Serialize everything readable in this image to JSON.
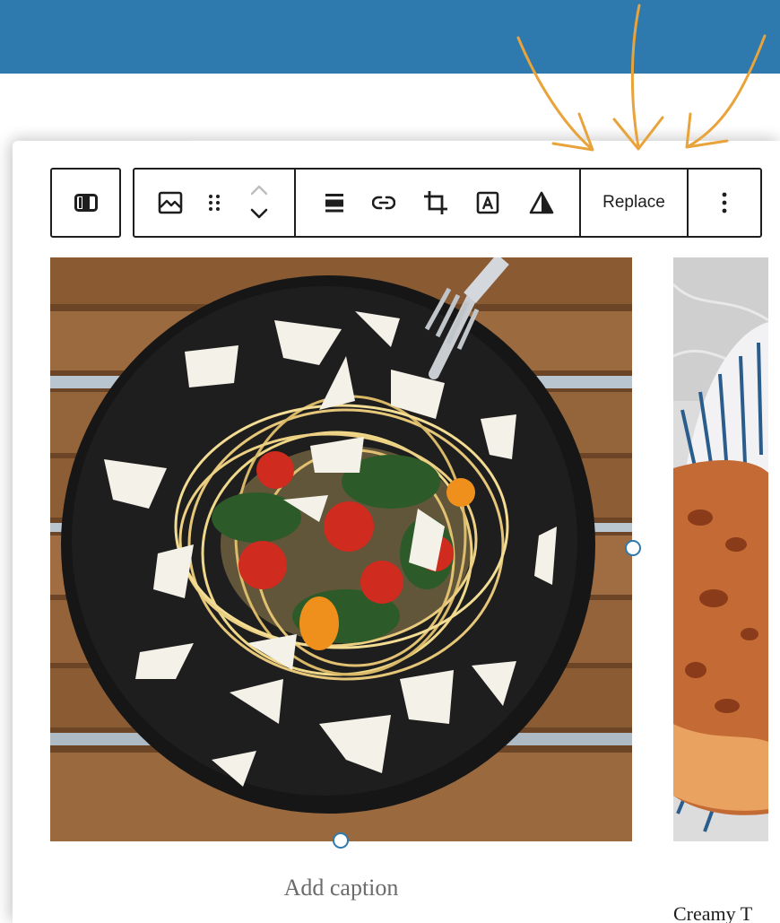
{
  "header": {
    "color": "#2e79ae"
  },
  "accent": {
    "arrows": "#e8a33a",
    "handles": "#2e79ae"
  },
  "toolbar": {
    "parent_select_icon": "columns-icon",
    "block_type_icon": "image-icon",
    "drag_icon": "drag-handle-icon",
    "move_icon": "chevron-up-down-icon",
    "align_icon": "align-icon",
    "link_icon": "link-icon",
    "crop_icon": "crop-icon",
    "text_overlay_icon": "text-overlay-icon",
    "duotone_icon": "duotone-icon",
    "replace_label": "Replace",
    "more_icon": "more-vertical-icon"
  },
  "images": [
    {
      "subject": "pasta-plate"
    },
    {
      "subject": "bread-plate"
    }
  ],
  "captions": {
    "placeholder": "Add caption",
    "second": "Creamy T"
  }
}
